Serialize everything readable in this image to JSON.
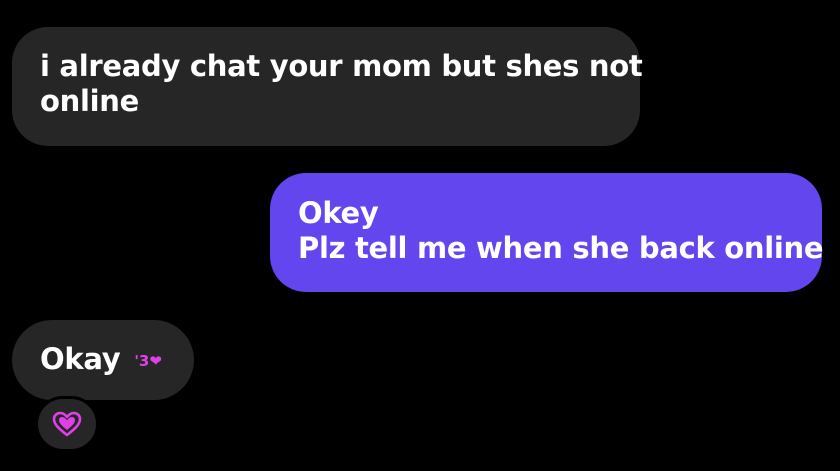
{
  "messages": [
    {
      "direction": "received",
      "lines": [
        "i already chat your mom but shes not",
        "online"
      ]
    },
    {
      "direction": "sent",
      "lines": [
        "Okey",
        "Plz tell me when she back online"
      ]
    },
    {
      "direction": "received",
      "text": "Okay",
      "emoticon": "'3❤"
    }
  ],
  "reaction": {
    "icon": "heart-icon",
    "color": "#e040e8"
  },
  "colors": {
    "background": "#000000",
    "received_bubble": "#262626",
    "sent_bubble": "#6446ef",
    "text": "#ffffff"
  }
}
